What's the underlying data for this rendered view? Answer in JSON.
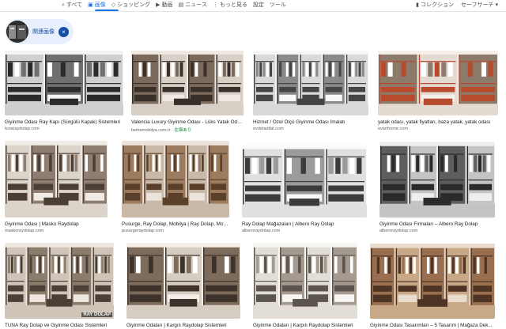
{
  "nav": {
    "tabs": [
      {
        "icon": "search-icon",
        "glyph": "⌕",
        "label": "すべて"
      },
      {
        "icon": "image-icon",
        "glyph": "▣",
        "label": "画像"
      },
      {
        "icon": "tag-icon",
        "glyph": "◇",
        "label": "ショッピング"
      },
      {
        "icon": "video-icon",
        "glyph": "▶",
        "label": "動画"
      },
      {
        "icon": "news-icon",
        "glyph": "▤",
        "label": "ニュース"
      },
      {
        "icon": "more-icon",
        "glyph": "⋮",
        "label": "もっと見る"
      },
      {
        "icon": "",
        "glyph": "",
        "label": "設定"
      },
      {
        "icon": "",
        "glyph": "",
        "label": "ツール"
      }
    ],
    "active_tab": 1,
    "collections_label": "コレクション",
    "safesearch_label": "セーフサーチ ▾"
  },
  "chip": {
    "label": "関連画像"
  },
  "results": [
    {
      "caption": "Giyinme Odası Ray Kapı (Sürgülü Kapak) Sistemleri",
      "source": "tunaraydolap.com",
      "badge": "",
      "watermark": "",
      "palette": [
        "#2b2b2b",
        "#6f6f6f",
        "#cfcfcf",
        "#f4f4f4"
      ]
    },
    {
      "caption": "Valencia Luxury Giyinme Odası - Lüks Yatak Odası",
      "source": "berkemobilya.com.tr",
      "badge": "在庫あり",
      "watermark": "",
      "palette": [
        "#3a302a",
        "#7b6a5c",
        "#d8d0c6",
        "#efe9e2"
      ]
    },
    {
      "caption": "Hizmet / Özel Ölçü Giyinme Odası İmalatı",
      "source": "evdetadilat.com",
      "badge": "",
      "watermark": "",
      "palette": [
        "#454545",
        "#8a8a8a",
        "#d9d9d9",
        "#f7f7f7"
      ]
    },
    {
      "caption": "yatak odası, yatak fiyatları, baza yatak, yatak odası",
      "source": "evarthome.com",
      "badge": "",
      "watermark": "",
      "palette": [
        "#b84a2e",
        "#8c7a6a",
        "#e3dbd2",
        "#f5f0ea"
      ]
    },
    {
      "caption": "Giyinme Odası | Masko Raydolap",
      "source": "maskoraydolap.com",
      "badge": "",
      "watermark": "",
      "palette": [
        "#4b3e35",
        "#8e7d70",
        "#dcd3ca",
        "#f0ebe5"
      ]
    },
    {
      "caption": "Pusurge, Ray Dolap, Mobilya | Ray Dolap, Mob...",
      "source": "pusurgeraydolap.com",
      "badge": "",
      "watermark": "",
      "palette": [
        "#5a3f2a",
        "#9c7b5e",
        "#c9b9a8",
        "#ece4dc"
      ]
    },
    {
      "caption": "Ray Dolap Mağazaları | Albero Ray Dolap",
      "source": "alberoraydolap.com",
      "badge": "",
      "watermark": "",
      "palette": [
        "#3b3b3b",
        "#9b9b9b",
        "#e0e0e0",
        "#fafafa"
      ]
    },
    {
      "caption": "Giyinme Odası Firmaları – Albero Ray Dolap",
      "source": "alberoraydolap.com",
      "badge": "",
      "watermark": "",
      "palette": [
        "#2a2a2a",
        "#5e5e5e",
        "#c4c4c4",
        "#eeeeee"
      ]
    },
    {
      "caption": "TUNA Ray Dolap ve Giyinme Odası Sistemleri",
      "source": "tunaraydolap.com",
      "badge": "",
      "watermark": "RAY DOLAP",
      "palette": [
        "#4a4036",
        "#8b7c6c",
        "#cfc4b8",
        "#efe8e0"
      ]
    },
    {
      "caption": "Giyinme Odaları | Kargılı Raydolap Sistemleri",
      "source": "karciliraydolap.com",
      "badge": "",
      "watermark": "",
      "palette": [
        "#3d332b",
        "#7d6b5b",
        "#d6cdc2",
        "#f3eee8"
      ]
    },
    {
      "caption": "Giyinme Odaları | Karpılı Raydolap Sistemleri",
      "source": "karciliraydolap.com",
      "badge": "",
      "watermark": "",
      "palette": [
        "#5b554e",
        "#a49a8f",
        "#e2ddd6",
        "#f8f6f3"
      ]
    },
    {
      "caption": "Giyinme Odası Tasarımları – 5 Tasarım | Mağaza Dek...",
      "source": "magazadekorasyon.com",
      "badge": "",
      "watermark": "",
      "palette": [
        "#4e3424",
        "#9a6f4f",
        "#c9a888",
        "#eadccc"
      ]
    }
  ]
}
